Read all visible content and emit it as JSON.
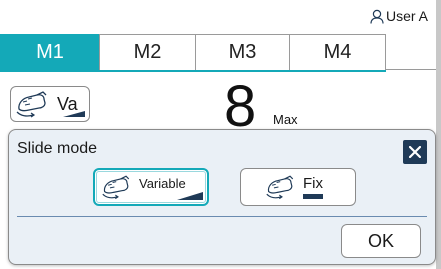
{
  "header": {
    "user_label": "User A",
    "user_icon": "user-icon"
  },
  "tabs": [
    {
      "label": "M1",
      "active": true
    },
    {
      "label": "M2",
      "active": false
    },
    {
      "label": "M3",
      "active": false
    },
    {
      "label": "M4",
      "active": false
    }
  ],
  "mode_bar": {
    "mode_abbrev": "Va",
    "mode_icon": "hand-tool-icon",
    "value": "8",
    "value_suffix": "Max"
  },
  "dialog": {
    "title": "Slide mode",
    "close_icon": "close-icon",
    "options": [
      {
        "label": "Variable",
        "icon": "hand-tool-icon",
        "selected": true
      },
      {
        "label": "Fix",
        "icon": "hand-tool-icon",
        "selected": false
      }
    ],
    "ok_label": "OK"
  },
  "colors": {
    "accent": "#14a9b8",
    "dark_blue": "#1f3a57",
    "dialog_bg": "#eaf0f6"
  }
}
